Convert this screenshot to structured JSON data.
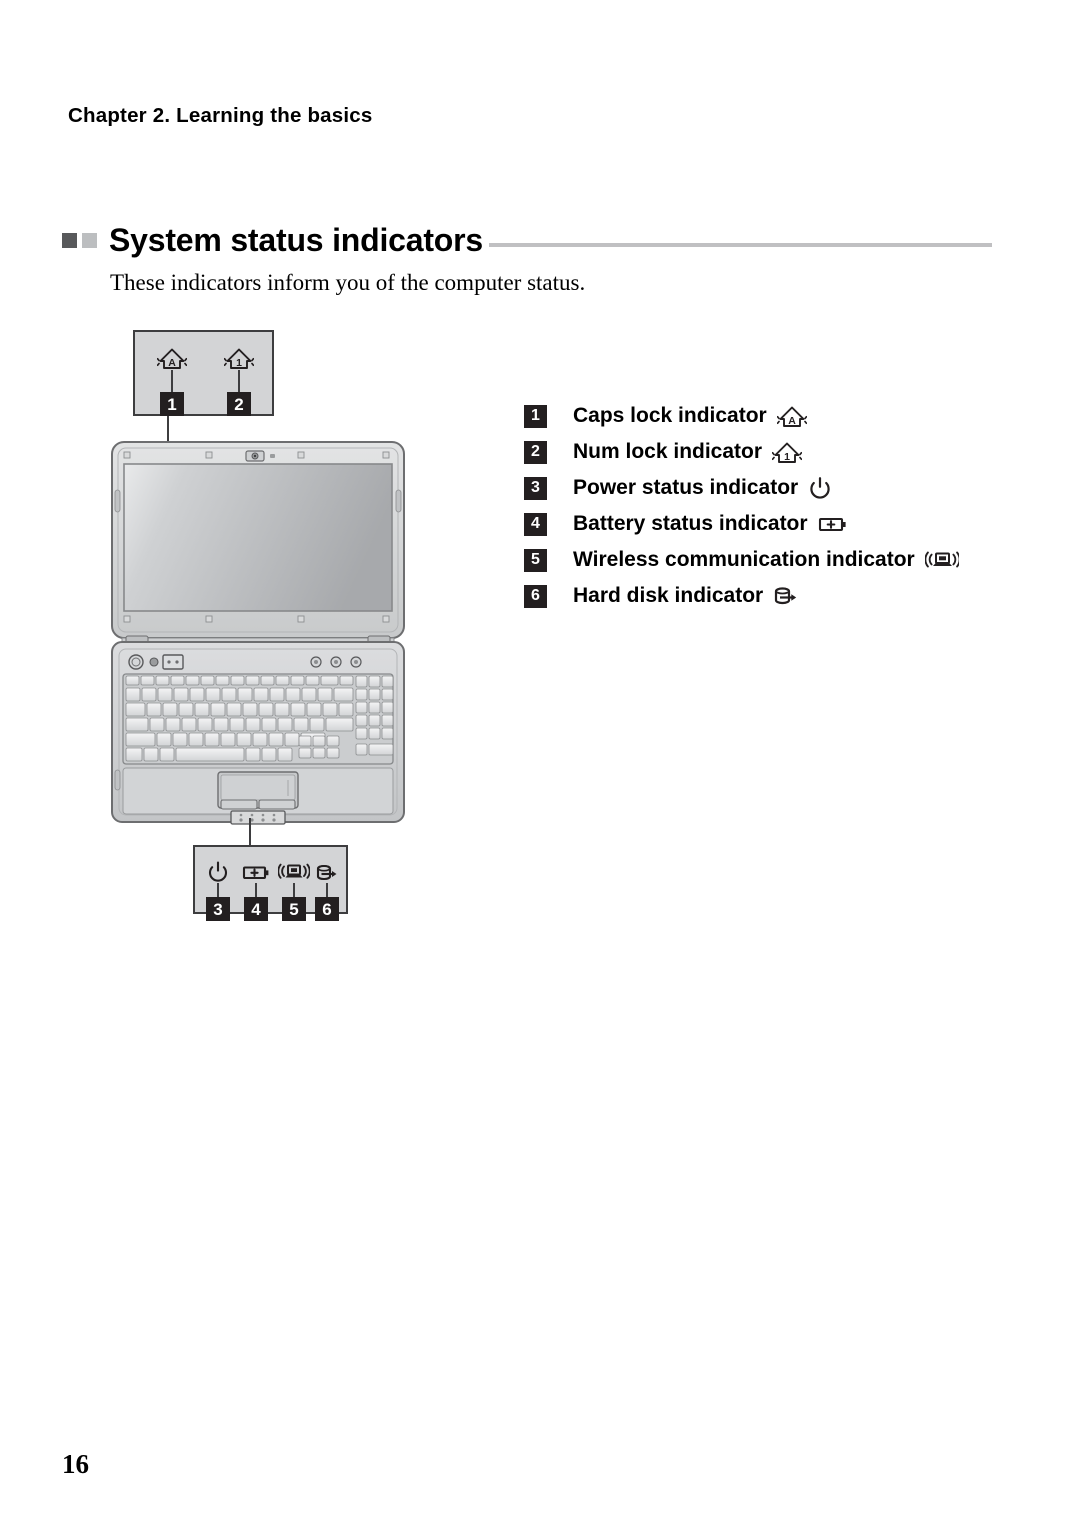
{
  "document": {
    "chapter_header": "Chapter 2. Learning the basics",
    "page_number": "16"
  },
  "section": {
    "title": "System status indicators",
    "intro": "These indicators inform you of the computer status.",
    "bullet_dark_color": "#58595b",
    "bullet_light_color": "#bcbec0",
    "rule_color": "#c0c0c2"
  },
  "legend": {
    "items": [
      {
        "number": "1",
        "label": "Caps lock indicator",
        "icon": "caps-lock-icon"
      },
      {
        "number": "2",
        "label": "Num lock indicator",
        "icon": "num-lock-icon"
      },
      {
        "number": "3",
        "label": "Power status indicator",
        "icon": "power-icon"
      },
      {
        "number": "4",
        "label": "Battery status indicator",
        "icon": "battery-icon"
      },
      {
        "number": "5",
        "label": "Wireless communication indicator",
        "icon": "wireless-icon"
      },
      {
        "number": "6",
        "label": "Hard disk indicator",
        "icon": "hard-disk-icon"
      }
    ]
  },
  "callout_top": {
    "badges": [
      "1",
      "2"
    ],
    "icons": [
      "caps-lock-icon",
      "num-lock-icon"
    ],
    "background": "#d3d4d6",
    "border": "#3d3d3f"
  },
  "callout_bottom": {
    "badges": [
      "3",
      "4",
      "5",
      "6"
    ],
    "icons": [
      "power-icon",
      "battery-icon",
      "wireless-icon",
      "hard-disk-icon"
    ],
    "background": "#d3d4d6",
    "border": "#3d3d3f"
  },
  "illustration": {
    "name": "notebook-computer-open-top-view"
  }
}
